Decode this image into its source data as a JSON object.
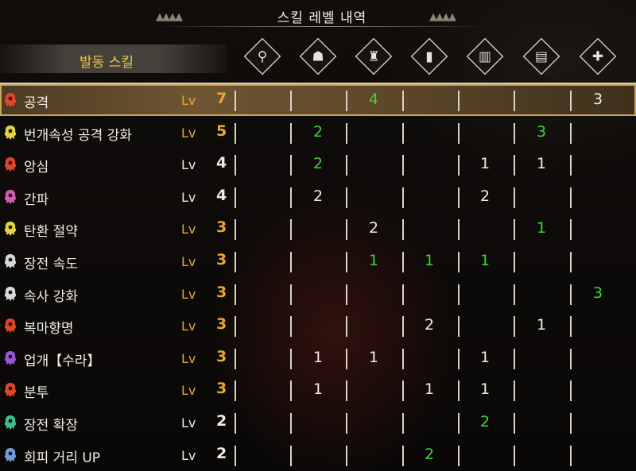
{
  "title": "스킬 레벨 내역",
  "skill_header": "발동 스킬",
  "equipment_icons": [
    "weapon-icon",
    "helmet-icon",
    "chest-icon",
    "arms-icon",
    "waist-icon",
    "legs-icon",
    "charm-icon"
  ],
  "level_prefix": "Lv",
  "colors": {
    "gold": "#e9a832",
    "green": "#3fd23f",
    "white": "#f0ece4",
    "selected_row": "#6e5532"
  },
  "skills": [
    {
      "name": "공격",
      "level": "7",
      "level_color": "gold",
      "icon_color": "#e0452a",
      "cells": [
        "",
        "",
        "4",
        "",
        "",
        "",
        "3"
      ],
      "cell_colors": [
        "",
        "",
        "g",
        "",
        "",
        "",
        "w"
      ],
      "selected": true
    },
    {
      "name": "번개속성 공격 강화",
      "level": "5",
      "level_color": "gold",
      "icon_color": "#e2d63a",
      "cells": [
        "",
        "2",
        "",
        "",
        "",
        "3",
        ""
      ],
      "cell_colors": [
        "",
        "g",
        "",
        "",
        "",
        "g",
        ""
      ]
    },
    {
      "name": "앙심",
      "level": "4",
      "level_color": "white",
      "icon_color": "#e0452a",
      "cells": [
        "",
        "2",
        "",
        "",
        "1",
        "1",
        ""
      ],
      "cell_colors": [
        "",
        "g",
        "",
        "",
        "w",
        "w",
        ""
      ]
    },
    {
      "name": "간파",
      "level": "4",
      "level_color": "white",
      "icon_color": "#d05cb4",
      "cells": [
        "",
        "2",
        "",
        "",
        "2",
        "",
        ""
      ],
      "cell_colors": [
        "",
        "w",
        "",
        "",
        "w",
        "",
        ""
      ]
    },
    {
      "name": "탄환 절약",
      "level": "3",
      "level_color": "gold",
      "icon_color": "#e2d63a",
      "cells": [
        "",
        "",
        "2",
        "",
        "",
        "1",
        ""
      ],
      "cell_colors": [
        "",
        "",
        "w",
        "",
        "",
        "g",
        ""
      ]
    },
    {
      "name": "장전 속도",
      "level": "3",
      "level_color": "gold",
      "icon_color": "#d8d8d8",
      "cells": [
        "",
        "",
        "1",
        "1",
        "1",
        "",
        ""
      ],
      "cell_colors": [
        "",
        "",
        "g",
        "g",
        "g",
        "",
        ""
      ]
    },
    {
      "name": "속사 강화",
      "level": "3",
      "level_color": "gold",
      "icon_color": "#d8d8d8",
      "cells": [
        "",
        "",
        "",
        "",
        "",
        "",
        "3"
      ],
      "cell_colors": [
        "",
        "",
        "",
        "",
        "",
        "",
        "g"
      ]
    },
    {
      "name": "복마향명",
      "level": "3",
      "level_color": "gold",
      "icon_color": "#e0452a",
      "cells": [
        "",
        "",
        "",
        "2",
        "",
        "1",
        ""
      ],
      "cell_colors": [
        "",
        "",
        "",
        "w",
        "",
        "w",
        ""
      ]
    },
    {
      "name": "업개【수라】",
      "level": "3",
      "level_color": "gold",
      "icon_color": "#9a55d8",
      "cells": [
        "",
        "1",
        "1",
        "",
        "1",
        "",
        ""
      ],
      "cell_colors": [
        "",
        "w",
        "w",
        "",
        "w",
        "",
        ""
      ]
    },
    {
      "name": "분투",
      "level": "3",
      "level_color": "gold",
      "icon_color": "#e0452a",
      "cells": [
        "",
        "1",
        "",
        "1",
        "1",
        "",
        ""
      ],
      "cell_colors": [
        "",
        "w",
        "",
        "w",
        "w",
        "",
        ""
      ]
    },
    {
      "name": "장전 확장",
      "level": "2",
      "level_color": "white",
      "icon_color": "#3fbf8a",
      "cells": [
        "",
        "",
        "",
        "",
        "2",
        "",
        ""
      ],
      "cell_colors": [
        "",
        "",
        "",
        "",
        "g",
        "",
        ""
      ]
    },
    {
      "name": "회피 거리 UP",
      "level": "2",
      "level_color": "white",
      "icon_color": "#6f9ad8",
      "cells": [
        "",
        "",
        "",
        "2",
        "",
        "",
        ""
      ],
      "cell_colors": [
        "",
        "",
        "",
        "g",
        "",
        "",
        ""
      ]
    }
  ]
}
